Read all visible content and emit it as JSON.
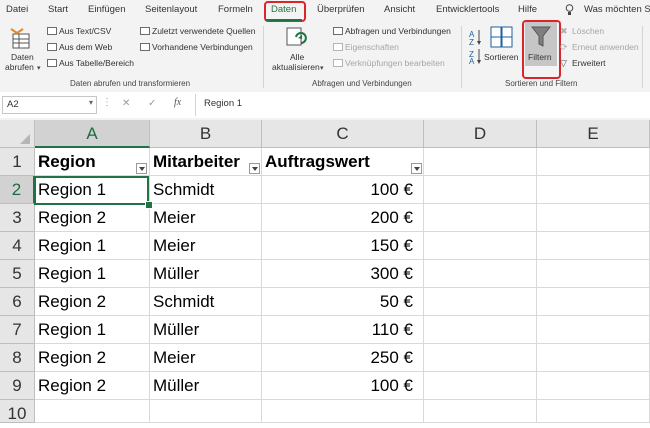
{
  "ribbon_tabs": [
    "Datei",
    "Start",
    "Einfügen",
    "Seitenlayout",
    "Formeln",
    "Daten",
    "Überprüfen",
    "Ansicht",
    "Entwicklertools",
    "Hilfe"
  ],
  "tell_me": "Was möchten Sie tun?",
  "ribbon": {
    "get_data": {
      "line1": "Daten",
      "line2": "abrufen"
    },
    "from_text_csv": "Aus Text/CSV",
    "from_web": "Aus dem Web",
    "from_table": "Aus Tabelle/Bereich",
    "recent_sources": "Zuletzt verwendete Quellen",
    "existing_connections": "Vorhandene Verbindungen",
    "group_get_transform": "Daten abrufen und transformieren",
    "refresh_all": {
      "line1": "Alle",
      "line2": "aktualisieren"
    },
    "queries_connections": "Abfragen und Verbindungen",
    "properties": "Eigenschaften",
    "edit_links": "Verknüpfungen bearbeiten",
    "group_queries": "Abfragen und Verbindungen",
    "sort": "Sortieren",
    "filter": "Filtern",
    "clear": "Löschen",
    "reapply": "Erneut anwenden",
    "advanced": "Erweitert",
    "group_sort_filter": "Sortieren und Filtern"
  },
  "formula_bar": {
    "name_box": "A2",
    "fx": "fx",
    "cancel": "✕",
    "enter": "✓",
    "content": "Region 1"
  },
  "columns": [
    "A",
    "B",
    "C",
    "D",
    "E"
  ],
  "rows": [
    "1",
    "2",
    "3",
    "4",
    "5",
    "6",
    "7",
    "8",
    "9",
    "10"
  ],
  "table": {
    "headers": [
      "Region",
      "Mitarbeiter",
      "Auftragswert"
    ],
    "data": [
      [
        "Region 1",
        "Schmidt",
        "100 €"
      ],
      [
        "Region 2",
        "Meier",
        "200 €"
      ],
      [
        "Region 1",
        "Meier",
        "150 €"
      ],
      [
        "Region 1",
        "Müller",
        "300 €"
      ],
      [
        "Region 2",
        "Schmidt",
        "50 €"
      ],
      [
        "Region 1",
        "Müller",
        "110 €"
      ],
      [
        "Region 2",
        "Meier",
        "250 €"
      ],
      [
        "Region 2",
        "Müller",
        "100 €"
      ]
    ]
  },
  "colors": {
    "accent": "#217346",
    "highlight": "#d9262c",
    "ribbon_bg": "#f3f3f3",
    "header_bg": "#e6e6e6"
  }
}
